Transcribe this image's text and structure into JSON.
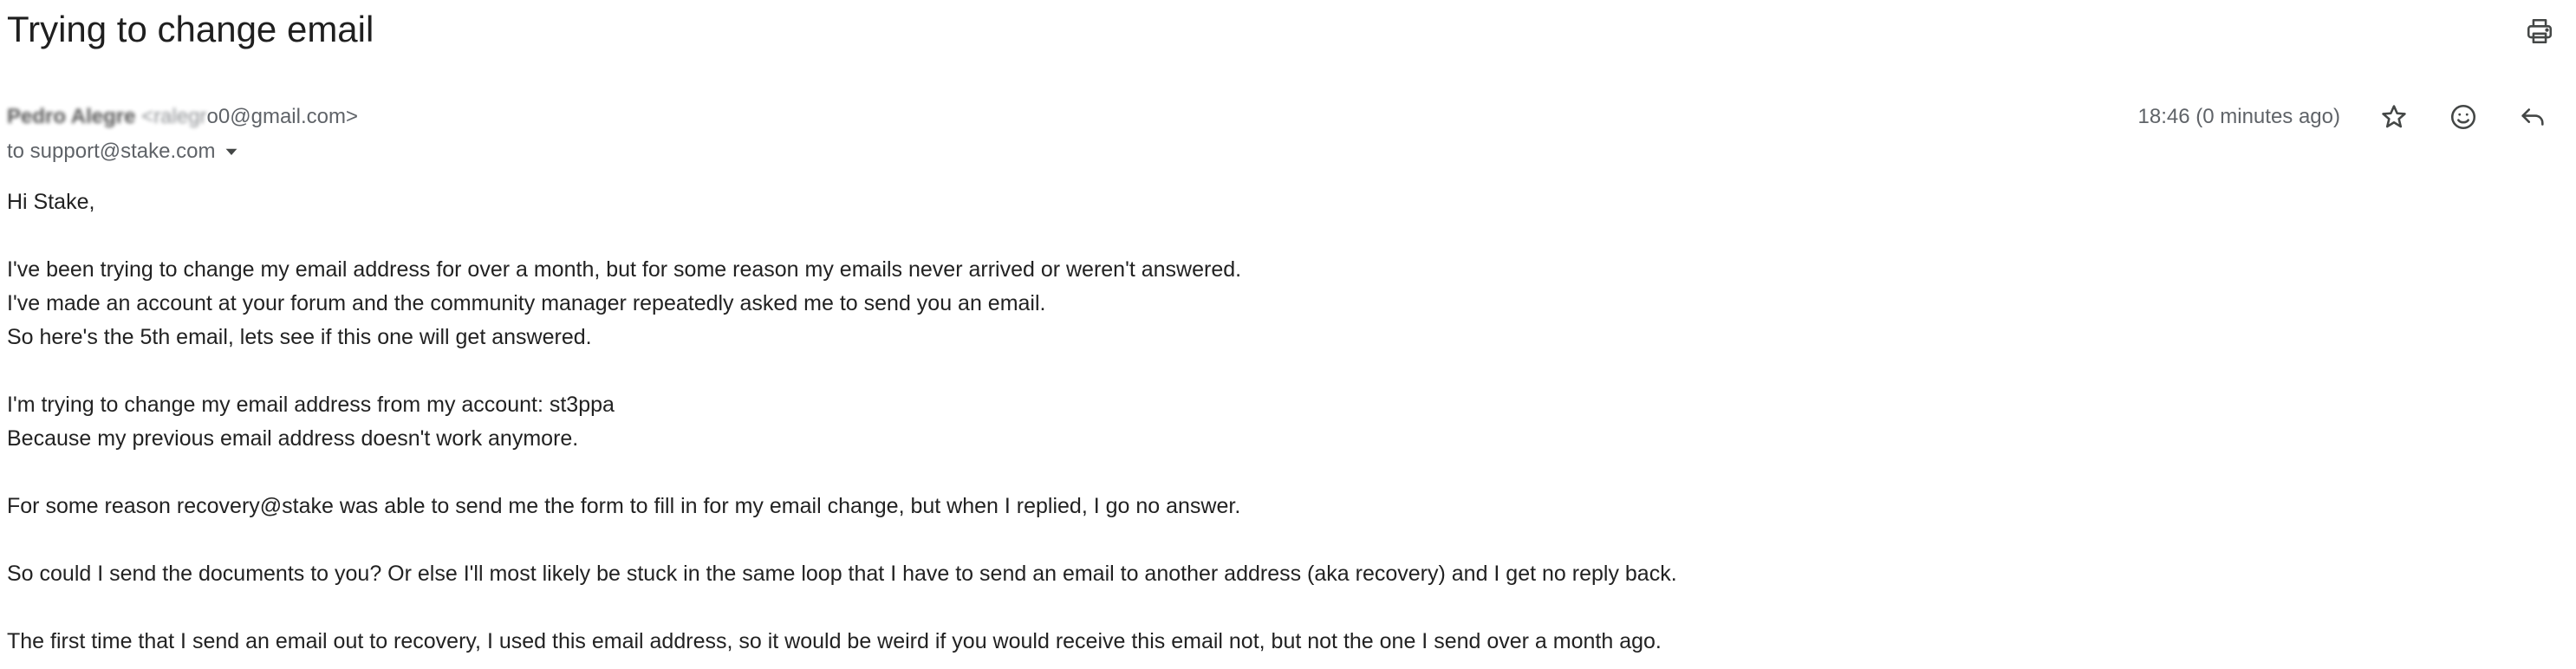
{
  "email": {
    "subject": "Trying to change email",
    "sender": {
      "name": "Pedro Alegre",
      "email_redacted": "<ralegr",
      "email_visible": "o0@gmail.com>"
    },
    "recipient": "to support@stake.com",
    "timestamp": "18:46 (0 minutes ago)",
    "body": [
      "Hi Stake,",
      "",
      "I've been trying to change my email address for over a month, but for some reason my emails never arrived or weren't answered.",
      "I've made an account at your forum and the community manager repeatedly asked me to send you an email.",
      "So here's the 5th email, lets see if this one will get answered.",
      "",
      "I'm trying to change my email address from my account: st3ppa",
      "Because my previous email address doesn't work anymore.",
      "",
      "For some reason recovery@stake was able to send me the form to fill in for my email change, but when I replied, I go no answer.",
      "",
      "So could I send the documents to you? Or else I'll most likely be stuck in the same loop that I have to send an email to another address (aka recovery) and I get no reply back.",
      "",
      "The first time that I send an email out to recovery, I used this email address, so it would be weird if you would receive this email not, but not the one I send over a month ago."
    ]
  },
  "icons": {
    "print": "print-icon",
    "star": "star-icon",
    "emoji": "emoji-icon",
    "reply": "reply-icon",
    "details": "chevron-down-icon"
  },
  "colors": {
    "text_primary": "#1f1f1f",
    "text_secondary": "#5f6368",
    "body_text": "#222222",
    "icon": "#444746"
  }
}
